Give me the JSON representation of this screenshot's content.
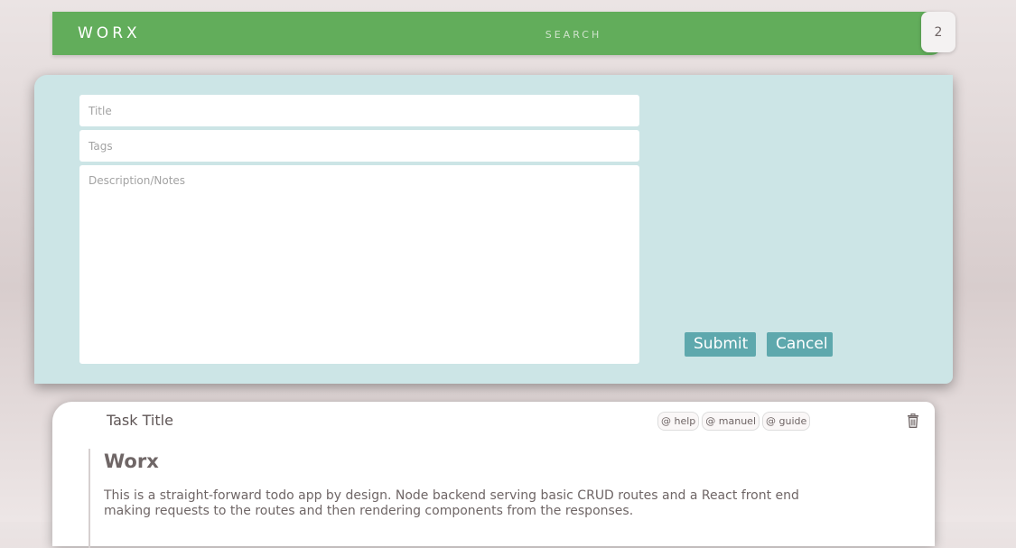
{
  "header": {
    "brand": "WORX",
    "search_placeholder": "SEARCH",
    "task_count": "2"
  },
  "form": {
    "title_placeholder": "Title",
    "tags_placeholder": "Tags",
    "description_placeholder": "Description/Notes",
    "submit_label": "Submit",
    "cancel_label": "Cancel"
  },
  "task": {
    "title": "Task Title",
    "tags": [
      "@ help",
      "@ manuel",
      "@ guide"
    ],
    "heading": "Worx",
    "description": "This is a straight-forward todo app by design. Node backend serving basic CRUD routes and a React front end making requests to the routes and then rendering components from the responses.",
    "delete_icon": "trash-icon"
  },
  "colors": {
    "header_green": "#62ad5b",
    "form_panel": "#cce5e6",
    "button_teal": "#5ea8ad",
    "background": "#ebe4e4"
  }
}
